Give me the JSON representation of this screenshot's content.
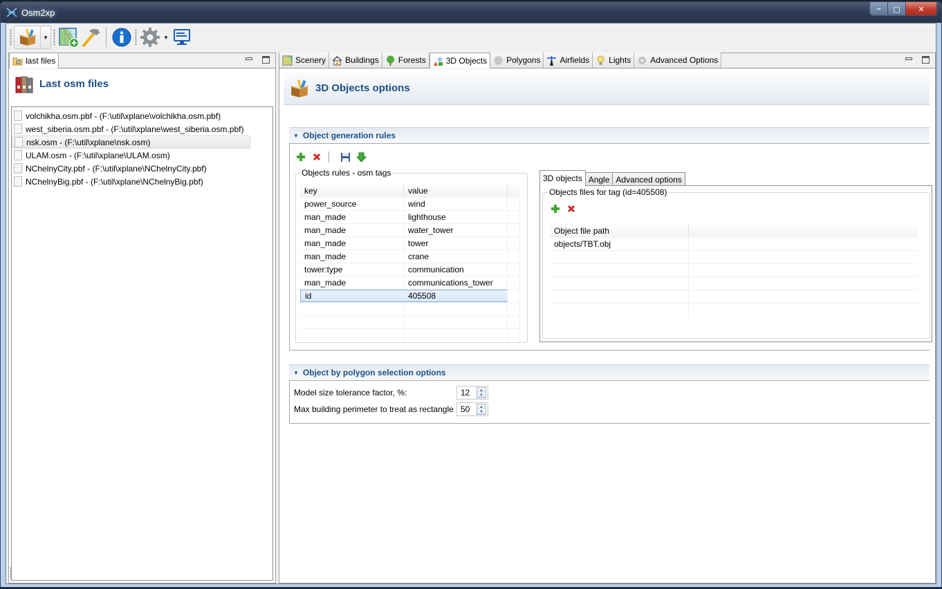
{
  "window": {
    "title": "Osm2xp",
    "controls": {
      "minimize": "–",
      "maximize": "▢",
      "close": "✕"
    }
  },
  "toolbar": {
    "items": [
      {
        "name": "generate-objects",
        "icon": "package-box-icon",
        "has_dropdown": true
      },
      {
        "name": "new-scenery",
        "icon": "map-add-icon"
      },
      {
        "name": "tools",
        "icon": "hammer-icon"
      },
      {
        "name": "about",
        "icon": "info-icon"
      },
      {
        "name": "settings",
        "icon": "gear-icon",
        "has_dropdown": true
      },
      {
        "name": "console",
        "icon": "monitor-icon"
      }
    ]
  },
  "left_panel": {
    "tab_label": "last files",
    "header_title": "Last osm files",
    "files": [
      {
        "label": "volchikha.osm.pbf  -  (F:\\util\\xplane\\volchikha.osm.pbf)",
        "selected": false
      },
      {
        "label": "west_siberia.osm.pbf  -  (F:\\util\\xplane\\west_siberia.osm.pbf)",
        "selected": false
      },
      {
        "label": "nsk.osm  -  (F:\\util\\xplane\\nsk.osm)",
        "selected": true
      },
      {
        "label": "ULAM.osm  -  (F:\\util\\xplane\\ULAM.osm)",
        "selected": false
      },
      {
        "label": "NChelnyCity.pbf  -  (F:\\util\\xplane\\NChelnyCity.pbf)",
        "selected": false
      },
      {
        "label": "NChelnyBig.pbf  -  (F:\\util\\xplane\\NChelnyBig.pbf)",
        "selected": false
      }
    ]
  },
  "right_panel": {
    "tabs": [
      {
        "label": "Scenery",
        "icon": "scenery-icon"
      },
      {
        "label": "Buildings",
        "icon": "house-icon"
      },
      {
        "label": "Forests",
        "icon": "tree-icon"
      },
      {
        "label": "3D Objects",
        "icon": "objects-3d-icon",
        "active": true
      },
      {
        "label": "Polygons",
        "icon": "polygon-icon"
      },
      {
        "label": "Airfields",
        "icon": "airfield-icon"
      },
      {
        "label": "Lights",
        "icon": "lightbulb-icon"
      },
      {
        "label": "Advanced Options",
        "icon": "gear-icon"
      }
    ],
    "form_title": "3D Objects options",
    "generation_rules": {
      "section_title": "Object generation rules",
      "rules_group_label": "Objects rules - osm tags",
      "columns": [
        "key",
        "value"
      ],
      "rows": [
        {
          "key": "power_source",
          "value": "wind"
        },
        {
          "key": "man_made",
          "value": "lighthouse"
        },
        {
          "key": "man_made",
          "value": "water_tower"
        },
        {
          "key": "man_made",
          "value": "tower"
        },
        {
          "key": "man_made",
          "value": "crane"
        },
        {
          "key": "tower:type",
          "value": "communication"
        },
        {
          "key": "man_made",
          "value": "communications_tower"
        },
        {
          "key": "id",
          "value": "405508",
          "selected": true
        }
      ],
      "subtabs": [
        {
          "label": "3D objects",
          "active": true
        },
        {
          "label": "Angle"
        },
        {
          "label": "Advanced options"
        }
      ],
      "files_group_label": "Objects files for tag (id=405508)",
      "files_columns": [
        "Object file path",
        ""
      ],
      "files_rows": [
        {
          "path": "objects/TBT.obj"
        }
      ]
    },
    "polygon_selection": {
      "section_title": "Object by polygon selection options",
      "fields": [
        {
          "label": "Model size tolerance factor, %:",
          "value": "12"
        },
        {
          "label": "Max building perimeter to treat as rectangle",
          "value": "50"
        }
      ]
    }
  }
}
